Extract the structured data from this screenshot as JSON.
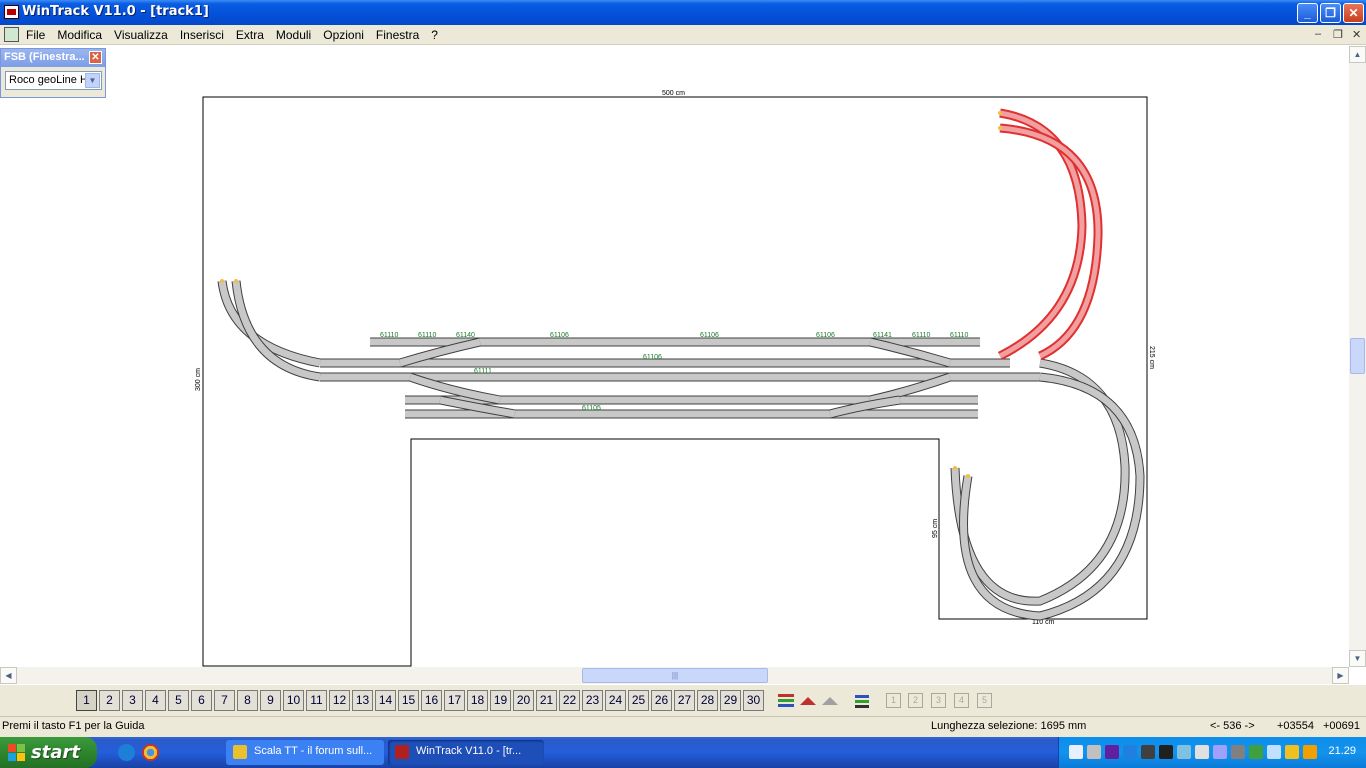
{
  "window": {
    "title": "WinTrack  V11.0 - [track1]"
  },
  "menu": {
    "items": [
      "File",
      "Modifica",
      "Visualizza",
      "Inserisci",
      "Extra",
      "Moduli",
      "Opzioni",
      "Finestra",
      "?"
    ]
  },
  "fsb": {
    "title": "FSB (Finestra...",
    "selected": "Roco geoLine H"
  },
  "layout": {
    "dim_top": "500 cm",
    "dim_left": "300 cm",
    "dim_right": "215 cm",
    "dim_inner_left": "95 cm",
    "dim_bottom": "110 cm",
    "track_labels": [
      "61110",
      "61110",
      "61140",
      "61106",
      "61106",
      "61106",
      "61141",
      "61110",
      "61110",
      "61111",
      "61106",
      "61105"
    ]
  },
  "layers": [
    "1",
    "2",
    "3",
    "4",
    "5",
    "6",
    "7",
    "8",
    "9",
    "10",
    "11",
    "12",
    "13",
    "14",
    "15",
    "16",
    "17",
    "18",
    "19",
    "20",
    "21",
    "22",
    "23",
    "24",
    "25",
    "26",
    "27",
    "28",
    "29",
    "30"
  ],
  "gray_buttons": [
    "1",
    "2",
    "3",
    "4",
    "5"
  ],
  "status": {
    "help": "Premi il tasto F1 per la Guida",
    "selection": "Lunghezza selezione:  1695 mm",
    "angle": "<- 536 ->",
    "x": "+03554",
    "y": "+00691"
  },
  "taskbar": {
    "start": "start",
    "tasks": [
      "Scala TT - il forum sull...",
      "WinTrack  V11.0 - [tr..."
    ],
    "clock": "21.29"
  },
  "colors": {
    "track_fill": "#c8c8c8",
    "track_edge": "#404040",
    "selected": "#e03030",
    "label": "#1a7a2a",
    "xp_blue": "#0450d8"
  }
}
